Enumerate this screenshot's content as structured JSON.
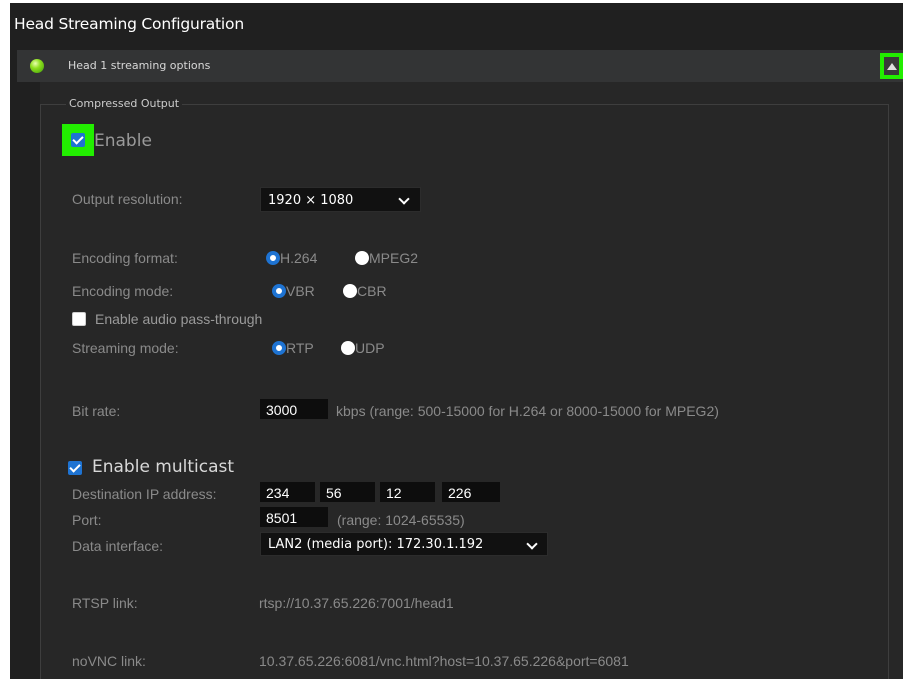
{
  "window": {
    "title": "Head Streaming Configuration"
  },
  "panel": {
    "title": "Head 1 streaming options",
    "status_icon": "green-led",
    "collapse_icon": "triangle-up-icon",
    "highlight_color": "#22ee00"
  },
  "compressed_output": {
    "legend": "Compressed Output",
    "enable": {
      "label": "Enable",
      "checked": true
    },
    "output_resolution": {
      "label": "Output resolution:",
      "value": "1920 × 1080"
    },
    "encoding_format": {
      "label": "Encoding format:",
      "options": [
        {
          "label": "H.264",
          "selected": true
        },
        {
          "label": "MPEG2",
          "selected": false
        }
      ]
    },
    "encoding_mode": {
      "label": "Encoding mode:",
      "options": [
        {
          "label": "VBR",
          "selected": true
        },
        {
          "label": "CBR",
          "selected": false
        }
      ]
    },
    "audio_passthrough": {
      "label": "Enable audio pass-through",
      "checked": false
    },
    "streaming_mode": {
      "label": "Streaming mode:",
      "options": [
        {
          "label": "RTP",
          "selected": true
        },
        {
          "label": "UDP",
          "selected": false
        }
      ]
    },
    "bit_rate": {
      "label": "Bit rate:",
      "value": "3000",
      "hint": "kbps (range: 500-15000 for H.264 or 8000-15000 for MPEG2)"
    },
    "multicast": {
      "label": "Enable multicast",
      "checked": true
    },
    "destination_ip": {
      "label": "Destination IP address:",
      "octets": [
        "234",
        "56",
        "12",
        "226"
      ]
    },
    "port": {
      "label": "Port:",
      "value": "8501",
      "hint": "(range: 1024-65535)"
    },
    "data_interface": {
      "label": "Data interface:",
      "value": "LAN2 (media port): 172.30.1.192"
    },
    "rtsp_link": {
      "label": "RTSP link:",
      "value": "rtsp://10.37.65.226:7001/head1"
    },
    "novnc_link": {
      "label": "noVNC link:",
      "value": "10.37.65.226:6081/vnc.html?host=10.37.65.226&port=6081"
    }
  },
  "colors": {
    "accent_blue": "#1e73d2",
    "background": "#202020",
    "panel_header": "#333435"
  }
}
